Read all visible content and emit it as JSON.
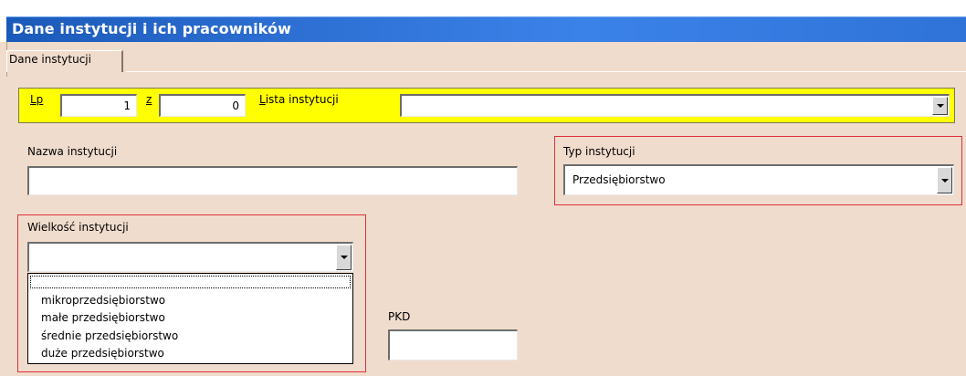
{
  "window": {
    "title": "Dane instytucji i ich pracowników"
  },
  "tabs": [
    {
      "label": "Dane instytucji"
    }
  ],
  "record_nav": {
    "lp_label": "Lp",
    "lp_value": "1",
    "of_label": "z",
    "of_value": "0",
    "list_label": "Lista instytucji",
    "list_value": ""
  },
  "form": {
    "nazwa_label": "Nazwa instytucji",
    "nazwa_value": "",
    "typ_label": "Typ instytucji",
    "typ_value": "Przedsiębiorstwo",
    "wielkosc_label": "Wielkość instytucji",
    "wielkosc_value": "",
    "wielkosc_options": [
      "",
      "mikroprzedsiębiorstwo",
      "małe przedsiębiorstwo",
      "średnie przedsiębiorstwo",
      "duże przedsiębiorstwo"
    ],
    "pkd_label": "PKD",
    "pkd_value": ""
  },
  "colors": {
    "background": "#f0dccd",
    "titlebar": "#2d6fd3",
    "nav_bar": "#ffff00",
    "highlight_border": "#e0303a"
  },
  "icons": {
    "dropdown": "chevron-down-icon"
  }
}
